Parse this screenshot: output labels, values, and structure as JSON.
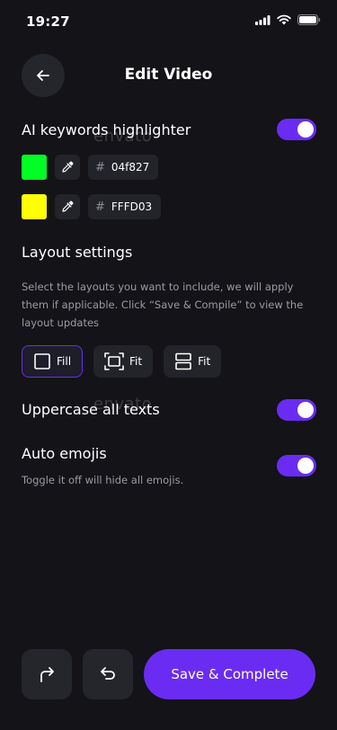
{
  "status_bar": {
    "time": "19:27"
  },
  "header": {
    "title": "Edit Video",
    "back_icon": "arrow-left-icon"
  },
  "ai_keywords": {
    "title": "AI keywords highlighter",
    "toggle_on": true,
    "colors": [
      {
        "swatch": "#00ff22",
        "hex": "04f827",
        "picker_icon": "eyedropper-icon"
      },
      {
        "swatch": "#ffff00",
        "hex": "FFFD03",
        "picker_icon": "eyedropper-icon"
      }
    ]
  },
  "layout_settings": {
    "title": "Layout settings",
    "description": "Select the layouts you want to include, we will apply them if applicable. Click “Save & Compile” to view the layout updates",
    "options": [
      {
        "label": "Fill",
        "icon": "square-icon",
        "selected": true
      },
      {
        "label": "Fit",
        "icon": "fit-frame-icon",
        "selected": false
      },
      {
        "label": "Fit",
        "icon": "split-vertical-icon",
        "selected": false
      }
    ]
  },
  "uppercase": {
    "title": "Uppercase all texts",
    "toggle_on": true
  },
  "auto_emojis": {
    "title": "Auto emojis",
    "subtitle": "Toggle it off will hide all emojis.",
    "toggle_on": true
  },
  "bottom": {
    "primary_label": "Save & Complete",
    "redo_icon": "redo-icon",
    "undo_icon": "undo-icon"
  },
  "watermark": {
    "text": "envato"
  },
  "colors": {
    "accent": "#6a2cf2",
    "background": "#131318",
    "surface": "#23232a"
  }
}
